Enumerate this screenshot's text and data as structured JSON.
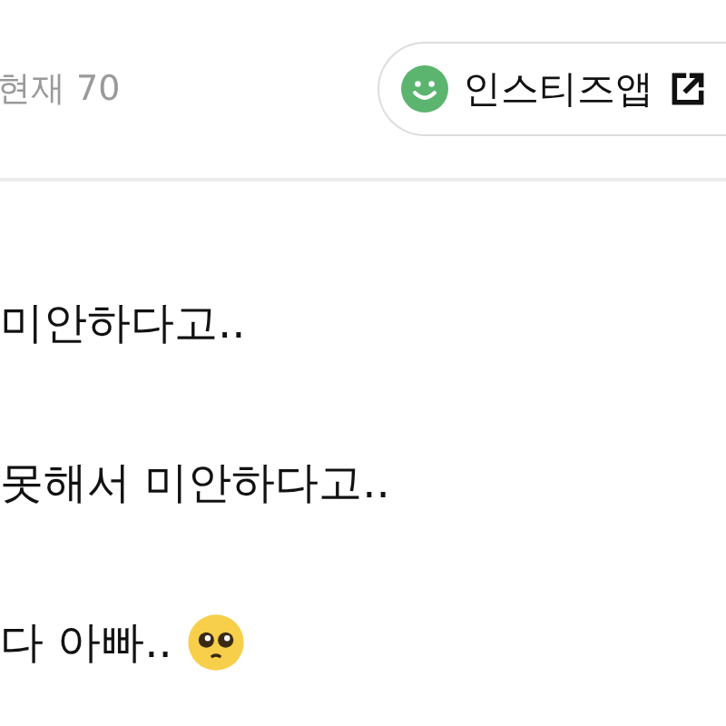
{
  "header": {
    "count_text": "현재 70",
    "app_button": {
      "label": "인스티즈앱"
    }
  },
  "body_lines": [
    {
      "text": "미안하다고..",
      "emoji": false
    },
    {
      "text": "못해서 미안하다고..",
      "emoji": false
    },
    {
      "text": "다 아빠..",
      "emoji": true
    }
  ]
}
